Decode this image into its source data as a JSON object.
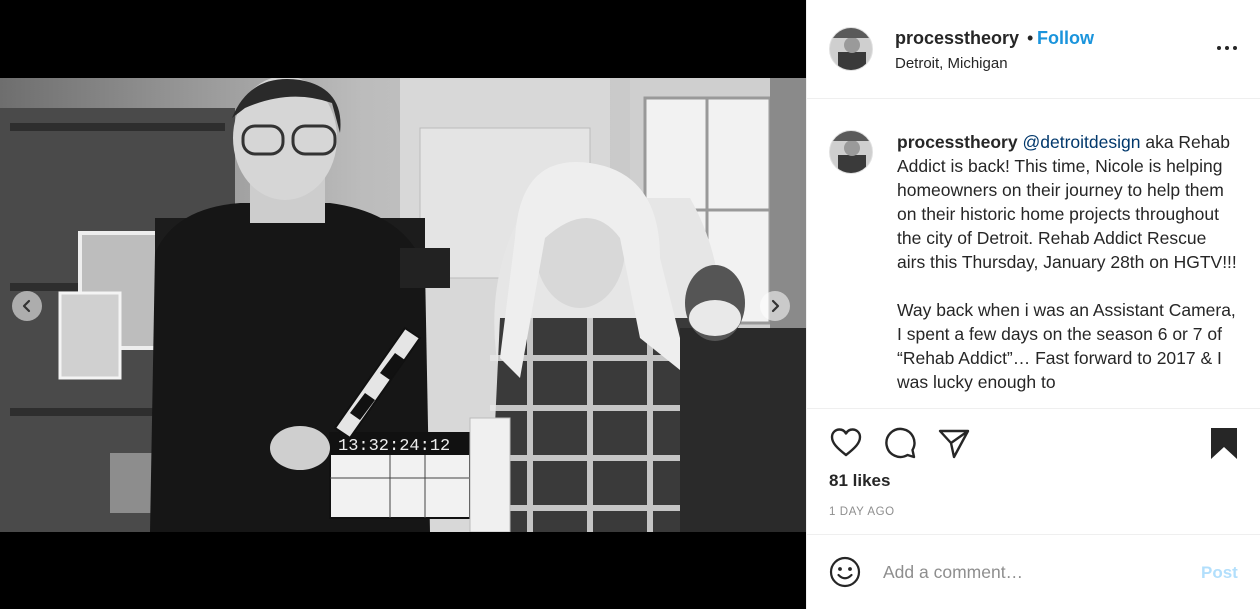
{
  "post": {
    "username": "processtheory",
    "separator": "•",
    "follow_label": "Follow",
    "location": "Detroit, Michigan",
    "caption": {
      "username": "processtheory",
      "mention": "@detroitdesign",
      "paragraph1_rest": " aka Rehab Addict is back! This time, Nicole is helping homeowners on their journey to help them on their historic home projects throughout the city of Detroit. Rehab Addict Rescue airs this Thursday, January 28th on HGTV!!!",
      "paragraph2": "Way back when i was an Assistant Camera, I spent a few days on the season 6 or 7 of “Rehab Addict”… Fast forward to 2017 & I was lucky enough to"
    },
    "likes": "81 likes",
    "time": "1 DAY AGO"
  },
  "comment_box": {
    "placeholder": "Add a comment…",
    "post_label": "Post"
  },
  "photo": {
    "slate_timecode": "13:32:24:12"
  },
  "icons": {
    "like": "heart-icon",
    "comment": "comment-icon",
    "share": "paper-plane-icon",
    "save": "bookmark-icon",
    "emoji": "smiley-icon",
    "more": "more-options-icon",
    "prev": "chevron-left-icon",
    "next": "chevron-right-icon"
  },
  "colors": {
    "follow": "#1a94dc",
    "post_button_disabled": "#b2dffc",
    "text": "#262626",
    "muted": "#8e8e8e"
  }
}
